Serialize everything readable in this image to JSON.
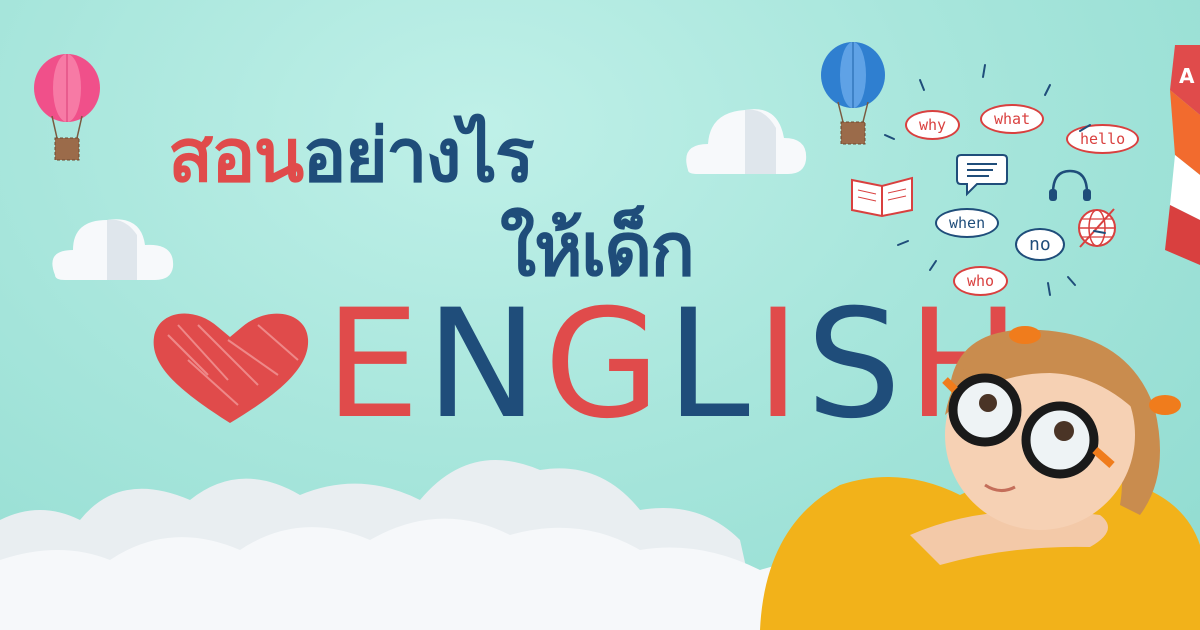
{
  "headline": {
    "line1_red": "สอน",
    "line1_blue": "อย่างไร",
    "line2": "ให้เด็ก",
    "english_letters": [
      {
        "char": "E",
        "color": "#e04b4b"
      },
      {
        "char": "N",
        "color": "#1f4d7a"
      },
      {
        "char": "G",
        "color": "#e04b4b"
      },
      {
        "char": "L",
        "color": "#1f4d7a"
      },
      {
        "char": "I",
        "color": "#e04b4b"
      },
      {
        "char": "S",
        "color": "#1f4d7a"
      },
      {
        "char": "H",
        "color": "#e04b4b"
      }
    ]
  },
  "word_bubbles": {
    "why": "why",
    "what": "what",
    "hello": "hello",
    "when": "when",
    "no": "no",
    "who": "who"
  },
  "colors": {
    "background": "#a8e6dc",
    "accent_red": "#e04b4b",
    "accent_blue": "#1f4d7a",
    "balloon_pink": "#f0508a",
    "balloon_blue": "#2f7fd0"
  },
  "icons": [
    "heart-icon",
    "book-icon",
    "chat-icon",
    "headphones-icon",
    "globe-icon",
    "hot-air-balloon-icon",
    "cloud-icon",
    "logo-mark"
  ]
}
